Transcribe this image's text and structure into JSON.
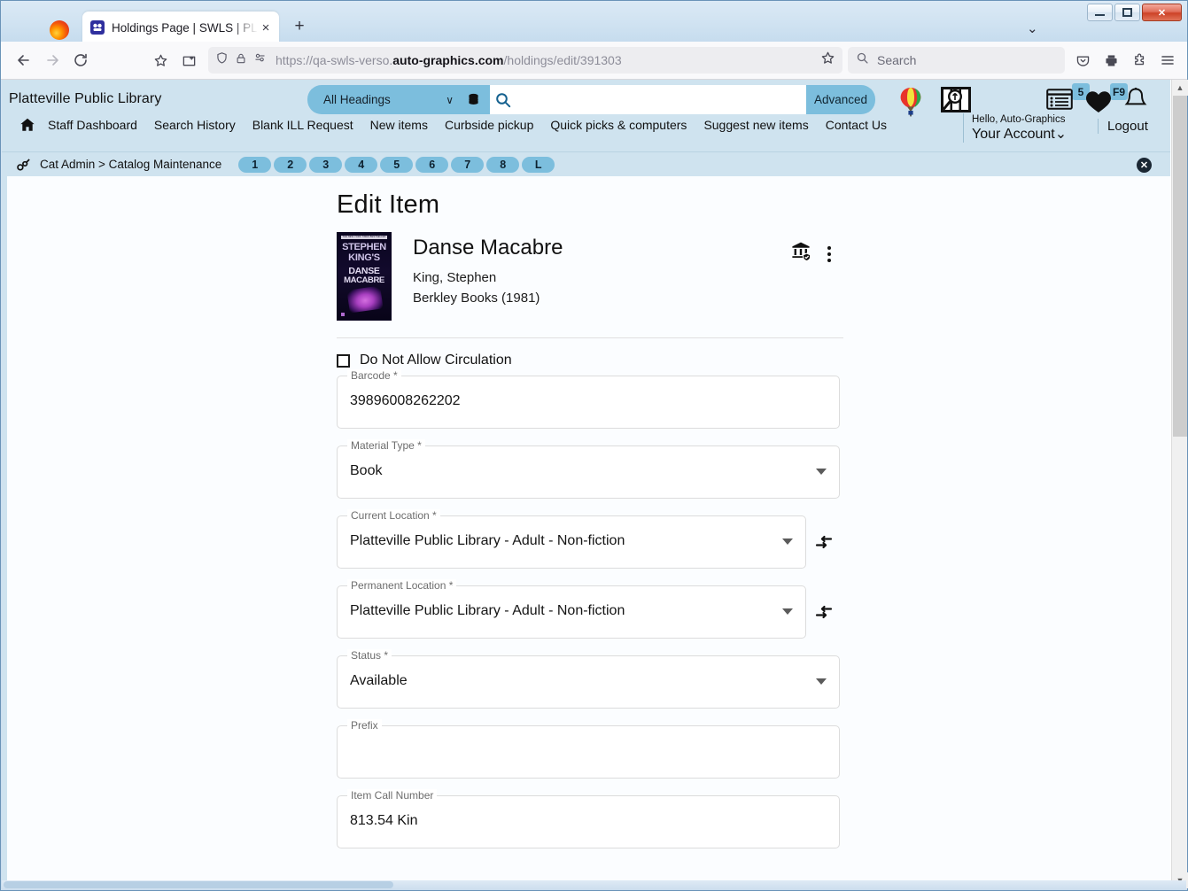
{
  "browser": {
    "tab": {
      "title": "Holdings Page | SWLS | PLATT |",
      "favicon": "site-favicon",
      "close_label": "×"
    },
    "new_tab_label": "+",
    "tab_list_chevron": "⌄",
    "window_controls": {
      "minimize": "minimize",
      "maximize": "maximize",
      "close": "✕"
    },
    "toolbar": {
      "back": "back-arrow",
      "forward": "forward-arrow",
      "reload": "reload",
      "bookmark_star": "star",
      "save_to_pocket_tab": "save-tab",
      "shield": "tracking-protection",
      "lock": "connection-secure",
      "permissions": "site-permissions",
      "url_prefix": "https://qa-swls-verso.",
      "url_domain": "auto-graphics.com",
      "url_suffix": "/holdings/edit/391303",
      "search_placeholder": "Search",
      "pocket": "pocket",
      "print": "print",
      "extensions": "extensions",
      "menu": "application-menu"
    }
  },
  "app": {
    "library_name": "Platteville Public Library",
    "search": {
      "scope_label": "All Headings",
      "scope_chevron": "∨",
      "database_icon": "database-icon",
      "query": "",
      "placeholder": "",
      "magnifier": "search-icon",
      "advanced_label": "Advanced"
    },
    "nav_links": [
      "Staff Dashboard",
      "Search History",
      "Blank ILL Request",
      "New items",
      "Curbside pickup",
      "Quick picks & computers",
      "Suggest new items",
      "Contact Us"
    ],
    "account": {
      "hello": "Hello, Auto-Graphics",
      "name": "Your Account",
      "chevron": "⌄",
      "logout": "Logout",
      "list_badge": "5",
      "heart_badge": "F9"
    },
    "breadcrumb": {
      "key_icon": "key-icon",
      "text": "Cat Admin > Catalog Maintenance",
      "steps": [
        "1",
        "2",
        "3",
        "4",
        "5",
        "6",
        "7",
        "8",
        "L"
      ],
      "close_label": "✕"
    }
  },
  "page": {
    "title": "Edit Item",
    "record": {
      "cover_band": "THE NEW YORK TIMES BESTSELLER",
      "cover_line1": "STEPHEN",
      "cover_line2": "KING'S",
      "cover_line3": "DANSE",
      "cover_line4": "MACABRE",
      "title": "Danse Macabre",
      "author": "King, Stephen",
      "publisher": "Berkley Books (1981)",
      "library_action": "library-verified-icon",
      "more_action": "kebab-menu-icon"
    },
    "checkbox": {
      "label": "Do Not Allow Circulation",
      "checked": false
    },
    "fields": [
      {
        "label": "Barcode *",
        "value": "39896008262202",
        "type": "text"
      },
      {
        "label": "Material Type *",
        "value": "Book",
        "type": "select"
      },
      {
        "label": "Current Location *",
        "value": "Platteville Public Library - Adult - Non-fiction",
        "type": "select-ext"
      },
      {
        "label": "Permanent Location *",
        "value": "Platteville Public Library - Adult - Non-fiction",
        "type": "select-ext"
      },
      {
        "label": "Status *",
        "value": "Available",
        "type": "select"
      },
      {
        "label": "Prefix",
        "value": "",
        "type": "text"
      },
      {
        "label": "Item Call Number",
        "value": "813.54 Kin",
        "type": "text"
      }
    ]
  },
  "colors": {
    "header_bg": "#cfe3ef",
    "accent": "#7cbedd",
    "page_bg": "#fbfdff",
    "text": "#111111"
  }
}
